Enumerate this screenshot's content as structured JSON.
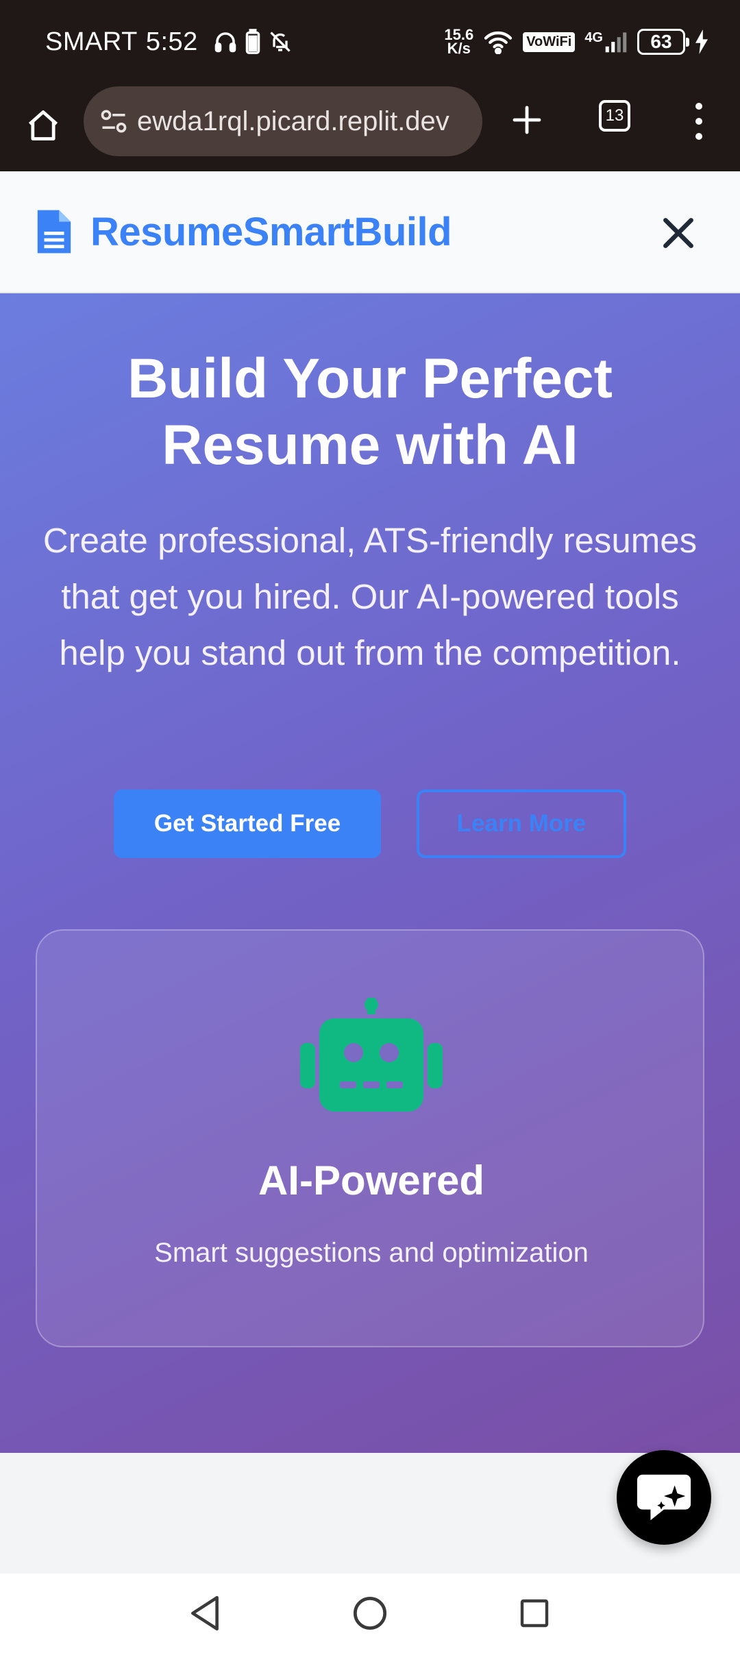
{
  "status_bar": {
    "carrier": "SMART",
    "time": "5:52",
    "net_speed_value": "15.6",
    "net_speed_unit": "K/s",
    "vowifi": "VoWiFi",
    "network_type": "4G",
    "battery": "63"
  },
  "browser": {
    "url": "ewda1rql.picard.replit.dev",
    "tab_count": "13"
  },
  "site": {
    "brand": "ResumeSmartBuild",
    "brand_color": "#3b82f6"
  },
  "hero": {
    "title_line1": "Build Your Perfect",
    "title_line2": "Resume with AI",
    "subtitle": "Create professional, ATS-friendly resumes that get you hired. Our AI-powered tools help you stand out from the competition.",
    "primary_button": "Get Started Free",
    "secondary_button": "Learn More"
  },
  "feature": {
    "icon": "robot-icon",
    "icon_color": "#10b981",
    "title": "AI-Powered",
    "description": "Smart suggestions and optimization"
  },
  "chat": {
    "icon": "chat-sparkle-icon"
  }
}
